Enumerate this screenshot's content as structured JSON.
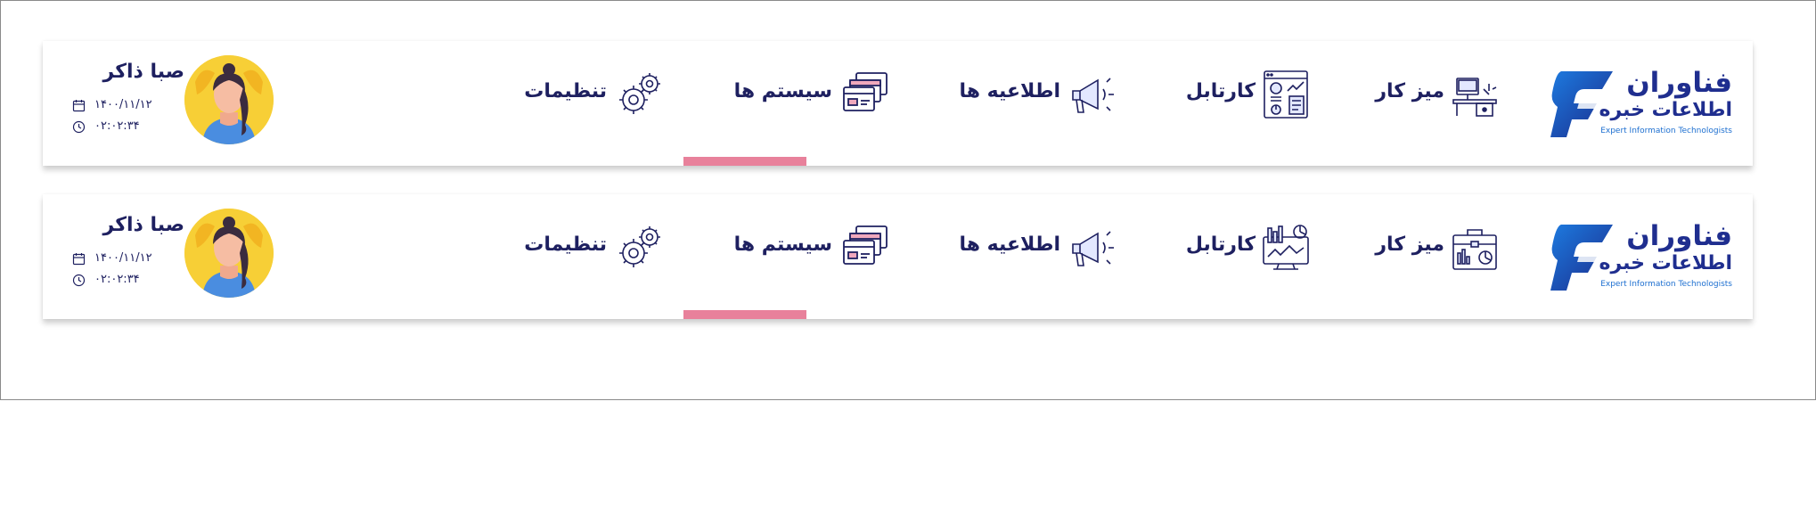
{
  "brand": {
    "name": "فناوران",
    "subtitle": "اطلاعات خبره",
    "tagline": "Expert Information Technologists",
    "primary_color": "#1f2e8f",
    "accent_color": "#e8819b"
  },
  "headers": [
    {
      "nav": [
        {
          "label": "میز کار",
          "icon": "desk-computer-icon"
        },
        {
          "label": "کارتابل",
          "icon": "cartable-document-icon"
        },
        {
          "label": "اطلاعیه ها",
          "icon": "megaphone-icon"
        },
        {
          "label": "سیستم ها",
          "icon": "stacked-windows-icon",
          "active": true
        },
        {
          "label": "تنظیمات",
          "icon": "gears-icon"
        }
      ],
      "user": {
        "name": "صبا ذاکر",
        "date": "۱۴۰۰/۱۱/۱۲",
        "time": "۰۲:۰۲:۳۴"
      }
    },
    {
      "nav": [
        {
          "label": "میز کار",
          "icon": "briefcase-icon"
        },
        {
          "label": "کارتابل",
          "icon": "monitor-chart-icon"
        },
        {
          "label": "اطلاعیه ها",
          "icon": "megaphone-icon"
        },
        {
          "label": "سیستم ها",
          "icon": "stacked-windows-icon",
          "active": true
        },
        {
          "label": "تنظیمات",
          "icon": "gears-icon"
        }
      ],
      "user": {
        "name": "صبا ذاکر",
        "date": "۱۴۰۰/۱۱/۱۲",
        "time": "۰۲:۰۲:۳۴"
      }
    }
  ]
}
